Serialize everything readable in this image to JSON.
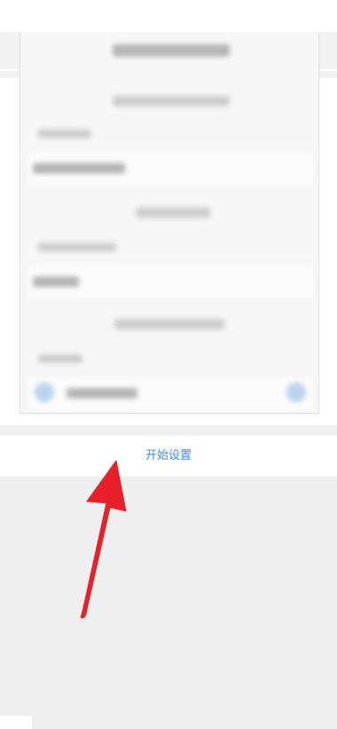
{
  "action": {
    "start_label": "开始设置",
    "color": "#3d8ee6"
  },
  "annotation": {
    "arrow_color": "#e8202a",
    "icon": "red-arrow-icon"
  },
  "colors": {
    "background": "#efefef",
    "surface": "#ffffff"
  }
}
